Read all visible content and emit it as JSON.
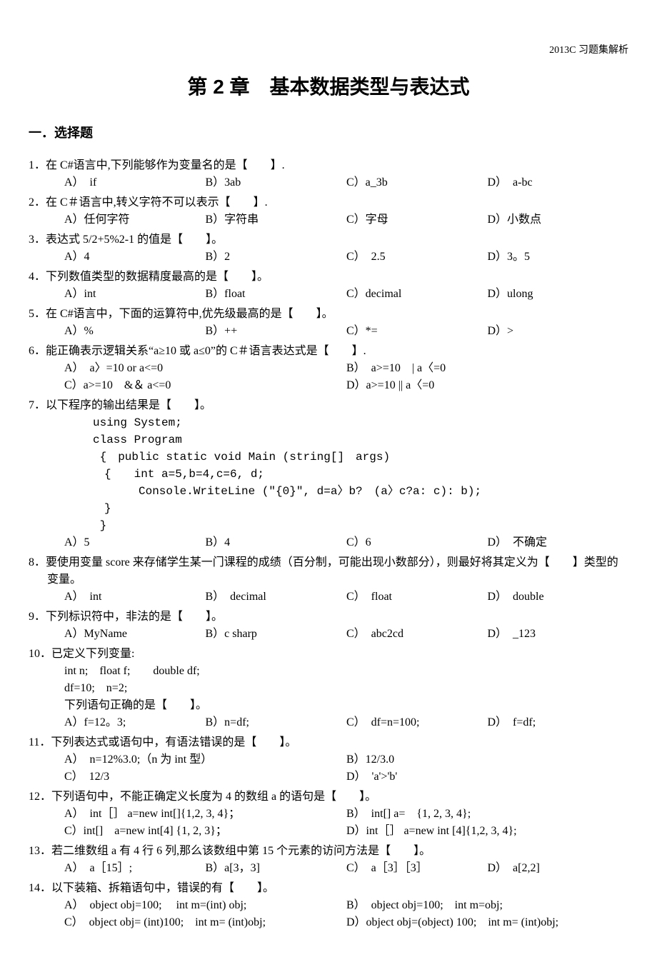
{
  "header_right": "2013C 习题集解析",
  "chapter_title": "第 2 章　基本数据类型与表达式",
  "section_title": "一．选择题",
  "questions": [
    {
      "num": "1．",
      "stem": "在 C#语言中,下列能够作为变量名的是【　　】.",
      "layout": "narrow",
      "opts": [
        "A）　if",
        "B）3ab",
        "C）a_3b",
        "D）　a-bc"
      ]
    },
    {
      "num": "2．",
      "stem": "在 C＃语言中,转义字符不可以表示【　　】.",
      "layout": "narrow",
      "opts": [
        "A）任何字符",
        "B）字符串",
        "C）字母",
        "D）小数点"
      ]
    },
    {
      "num": "3．",
      "stem": "表达式 5/2+5%2-1 的值是【　　】。",
      "layout": "narrow",
      "opts": [
        "A）4",
        "B）2",
        "C）　2.5",
        "D）3。5"
      ]
    },
    {
      "num": "4．",
      "stem": "下列数值类型的数据精度最高的是【　　】。",
      "layout": "narrow",
      "opts": [
        "A）int",
        "B）float",
        "C）decimal",
        "D）ulong"
      ]
    },
    {
      "num": "5．",
      "stem": "在 C#语言中，下面的运算符中,优先级最高的是【　　】。",
      "layout": "narrow",
      "opts": [
        "A）%",
        "B）++",
        "C）*=",
        "D）>"
      ]
    },
    {
      "num": "6．",
      "stem": "能正确表示逻辑关系“a≥10 或 a≤0”的 C＃语言表达式是【　　】.",
      "layout": "wide",
      "opts": [
        "A）　a〉=10 or a<=0",
        "B）　a>=10　| a〈=0",
        "C）a>=10　&＆ a<=0",
        "D）a>=10 || a〈=0"
      ]
    },
    {
      "num": "7．",
      "stem": "以下程序的输出结果是【　　】。",
      "code": "using System;\nclass Program\n {　public static void Main (string[]　args)\n　{　　int a=5,b=4,c=6, d;\n　　　　Console.WriteLine (\"{0}\", d=a〉b?　(a〉c?a: c): b);\n　}\n }",
      "layout": "narrow",
      "opts": [
        "A）5",
        "B）4",
        "C）6",
        "D）　不确定"
      ]
    },
    {
      "num": "8．",
      "stem": "要使用变量 score 来存储学生某一门课程的成绩（百分制，可能出现小数部分），则最好将其定义为【　　】类型的变量。",
      "layout": "narrow",
      "opts": [
        "A）　int",
        "B）　decimal",
        "C）　float",
        "D）　double"
      ]
    },
    {
      "num": "9．",
      "stem": "下列标识符中，非法的是【　　】。",
      "layout": "narrow",
      "opts": [
        "A）MyName",
        "B）c sharp",
        "C）　abc2cd",
        "D）　_123"
      ]
    },
    {
      "num": "10．",
      "stem": "已定义下列变量:",
      "sub": [
        " int n;　float f;　　double df;",
        " df=10;　n=2;",
        "下列语句正确的是【　　】。"
      ],
      "layout": "narrow",
      "opts": [
        "A）f=12。3;",
        "B）n=df;",
        "C）　df=n=100;",
        "D）　f=df;"
      ]
    },
    {
      "num": "11．",
      "stem": "下列表达式或语句中，有语法错误的是【　　】。",
      "layout": "wide",
      "opts": [
        "A）　n=12%3.0;（n 为 int 型）",
        "B）12/3.0",
        "C）　12/3",
        "D）　'a'>'b'"
      ]
    },
    {
      "num": "12．",
      "stem": "下列语句中，不能正确定义长度为 4 的数组 a 的语句是【　　】。",
      "layout": "wide",
      "opts": [
        "A）　int［］ a=new int[]{1,2, 3, 4}；",
        "B）　int[] a=　{1, 2, 3, 4};",
        "C）int[]　a=new int[4] {1, 2, 3}；",
        "D）int［］ a=new int [4]{1,2, 3, 4};"
      ]
    },
    {
      "num": "13．",
      "stem": "若二维数组 a 有 4 行 6 列,那么该数组中第 15 个元素的访问方法是【　　】。",
      "layout": "narrow",
      "opts": [
        "A）　a［15］;",
        "B）a[3，3]",
        "C）　a［3］［3］",
        "D）　a[2,2]"
      ]
    },
    {
      "num": "14．",
      "stem": "以下装箱、拆箱语句中，错误的有【　　】。",
      "layout": "wide",
      "opts": [
        "A）　object obj=100;　 int m=(int) obj;",
        "B）　object obj=100;　int m=obj;",
        "C）　object obj= (int)100;　int m= (int)obj;",
        "D）object obj=(object) 100;　int m= (int)obj;"
      ]
    }
  ]
}
